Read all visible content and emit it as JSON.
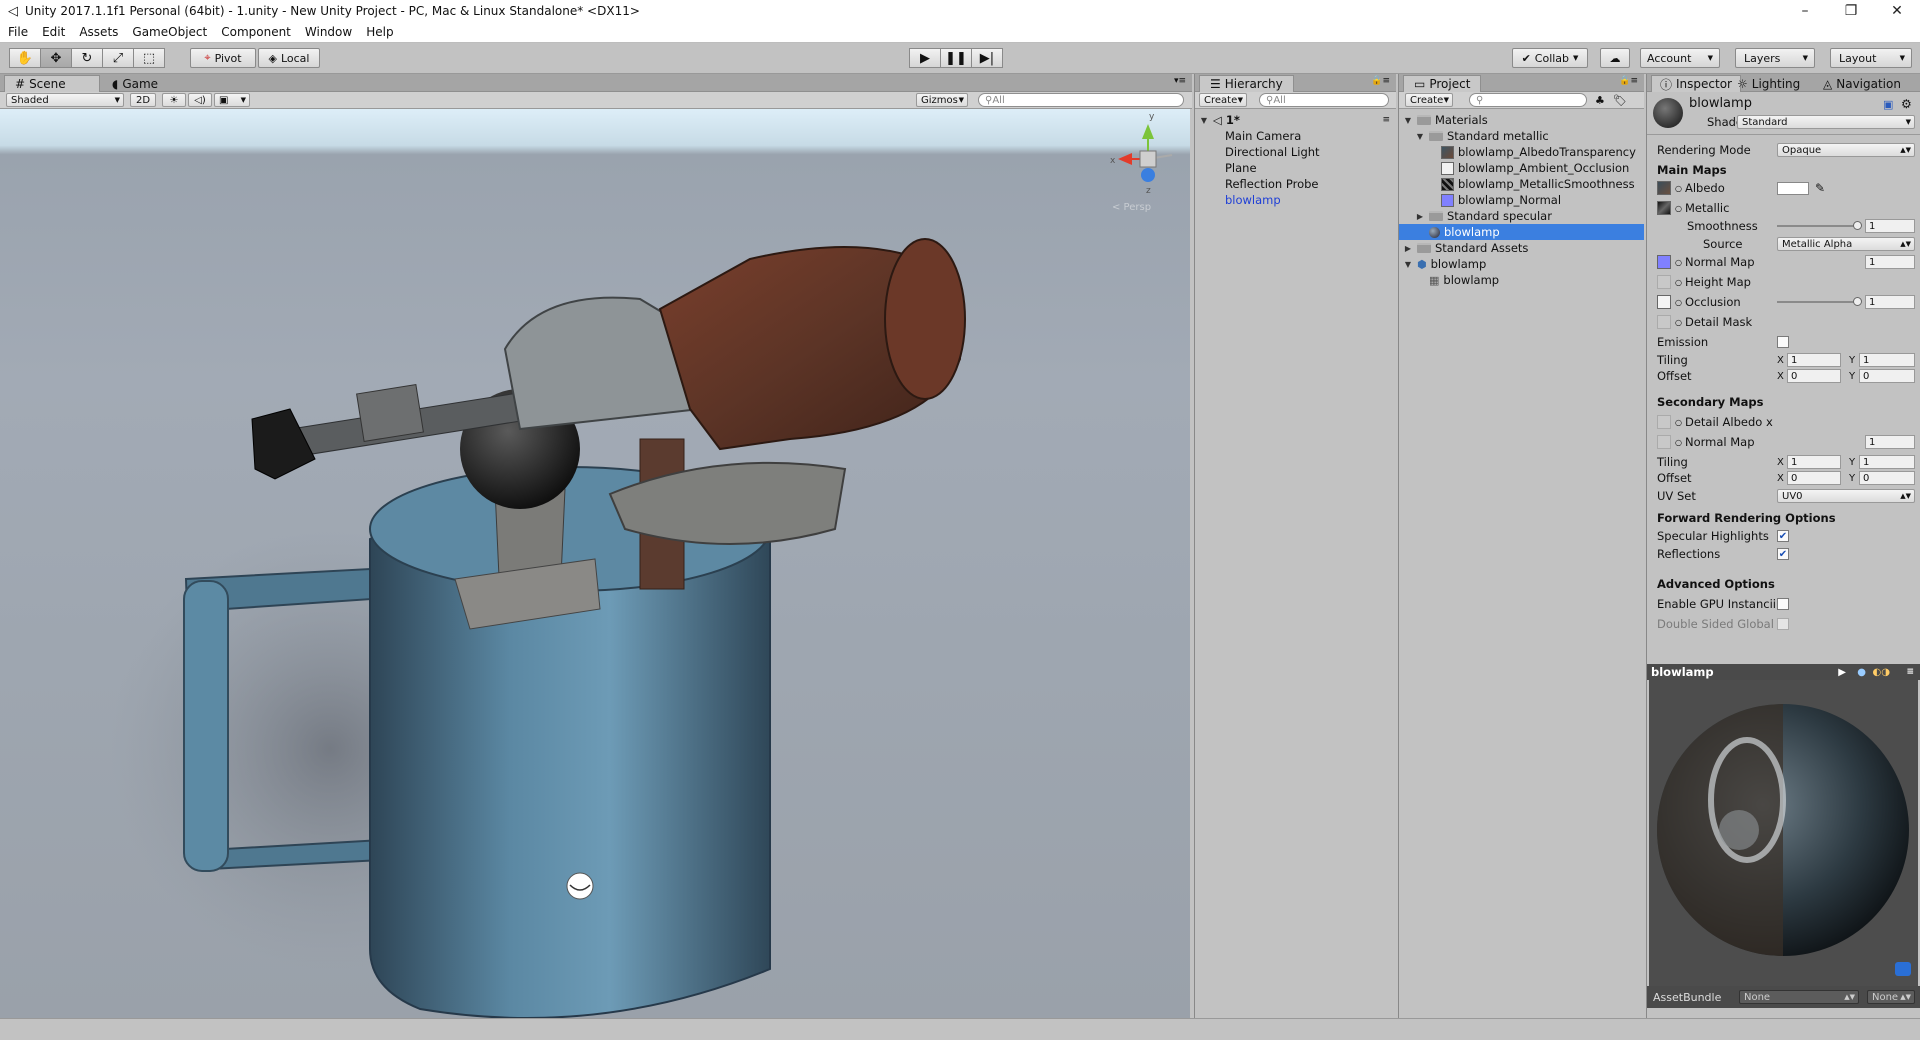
{
  "window": {
    "title": "Unity 2017.1.1f1 Personal (64bit) - 1.unity - New Unity Project - PC, Mac & Linux Standalone* <DX11>",
    "minimize": "–",
    "maximize": "❐",
    "close": "✕"
  },
  "menu": [
    "File",
    "Edit",
    "Assets",
    "GameObject",
    "Component",
    "Window",
    "Help"
  ],
  "toolbar": {
    "tools": [
      "hand-icon",
      "move-icon",
      "rotate-icon",
      "scale-icon",
      "rect-tool-icon"
    ],
    "pivot": "Pivot",
    "local": "Local",
    "collab": "Collab",
    "account": "Account",
    "layers": "Layers",
    "layout": "Layout"
  },
  "scene": {
    "tabs": [
      "Scene",
      "Game"
    ],
    "shading": "Shaded",
    "mode_2d": "2D",
    "gizmos": "Gizmos",
    "search": "All",
    "persp": "< Persp",
    "gizmo_labels": {
      "y": "y",
      "z": "z",
      "x": "x"
    }
  },
  "hierarchy": {
    "tab": "Hierarchy",
    "create": "Create",
    "search": "All",
    "scene_name": "1*",
    "items": [
      "Main Camera",
      "Directional Light",
      "Plane",
      "Reflection Probe",
      "blowlamp"
    ]
  },
  "project": {
    "tab": "Project",
    "create": "Create",
    "items": [
      {
        "label": "Materials",
        "kind": "folder",
        "depth": 0,
        "open": true
      },
      {
        "label": "Standard metallic",
        "kind": "folder",
        "depth": 1,
        "open": true
      },
      {
        "label": "blowlamp_AlbedoTransparency",
        "kind": "texture",
        "depth": 2
      },
      {
        "label": "blowlamp_Ambient_Occlusion",
        "kind": "texture-white",
        "depth": 2
      },
      {
        "label": "blowlamp_MetallicSmoothness",
        "kind": "texture-dark",
        "depth": 2
      },
      {
        "label": "blowlamp_Normal",
        "kind": "texture-normal",
        "depth": 2
      },
      {
        "label": "Standard specular",
        "kind": "folder",
        "depth": 1,
        "open": false
      },
      {
        "label": "blowlamp",
        "kind": "material",
        "depth": 1,
        "selected": true
      },
      {
        "label": "Standard Assets",
        "kind": "folder",
        "depth": 0,
        "open": false
      },
      {
        "label": "blowlamp",
        "kind": "model",
        "depth": 0,
        "open": true
      },
      {
        "label": "blowlamp",
        "kind": "mesh",
        "depth": 1
      }
    ]
  },
  "inspector": {
    "tabs": [
      "Inspector",
      "Lighting",
      "Navigation"
    ],
    "material_name": "blowlamp",
    "shader_label": "Shader",
    "shader_value": "Standard",
    "rendering_mode_label": "Rendering Mode",
    "rendering_mode_value": "Opaque",
    "main_maps_header": "Main Maps",
    "albedo": "Albedo",
    "metallic": "Metallic",
    "smoothness": "Smoothness",
    "smoothness_value": "1",
    "smoothness_level": 1.0,
    "source_label": "Source",
    "source_value": "Metallic Alpha",
    "normal_map": "Normal Map",
    "normal_value": "1",
    "height_map": "Height Map",
    "occlusion": "Occlusion",
    "occlusion_value": "1",
    "occlusion_level": 1.0,
    "detail_mask": "Detail Mask",
    "emission": "Emission",
    "tiling": "Tiling",
    "offset": "Offset",
    "x": "X",
    "y": "Y",
    "tiling_x": "1",
    "tiling_y": "1",
    "offset_x": "0",
    "offset_y": "0",
    "secondary_header": "Secondary Maps",
    "detail_albedo": "Detail Albedo x",
    "sec_normal_map": "Normal Map",
    "sec_normal_value": "1",
    "sec_tiling_x": "1",
    "sec_tiling_y": "1",
    "sec_offset_x": "0",
    "sec_offset_y": "0",
    "uv_set_label": "UV Set",
    "uv_set_value": "UV0",
    "forward_header": "Forward Rendering Options",
    "specular_highlights": "Specular Highlights",
    "reflections": "Reflections",
    "advanced_header": "Advanced Options",
    "gpu_instancing": "Enable GPU Instancii",
    "double_sided": "Double Sided Global",
    "preview_title": "blowlamp",
    "assetbundle_label": "AssetBundle",
    "assetbundle_value": "None",
    "assetbundle_variant": "None"
  },
  "colors": {
    "selection": "#3b7fe0",
    "hier_blue_text": "#1f3fd6",
    "normal_map_purple": "#8080ff"
  }
}
